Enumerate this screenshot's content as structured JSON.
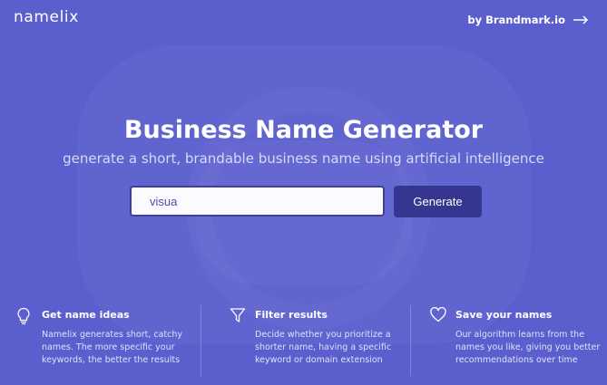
{
  "header": {
    "logo": "namelix",
    "brand_link": "by Brandmark.io"
  },
  "hero": {
    "title": "Business Name Generator",
    "subtitle": "generate a short, brandable business name using artificial intelligence"
  },
  "search": {
    "value": "visua",
    "button_label": "Generate"
  },
  "features": [
    {
      "icon": "lightbulb-icon",
      "title": "Get name ideas",
      "description": "Namelix generates short, catchy names. The more specific your keywords, the better the results"
    },
    {
      "icon": "filter-icon",
      "title": "Filter results",
      "description": "Decide whether you prioritize a shorter name, having a specific keyword or domain extension"
    },
    {
      "icon": "heart-icon",
      "title": "Save your names",
      "description": "Our algorithm learns from the names you like, giving you better recommendations over time"
    }
  ],
  "colors": {
    "background": "#5b5fce",
    "button": "#34368f",
    "input_border": "#3d3f99"
  }
}
